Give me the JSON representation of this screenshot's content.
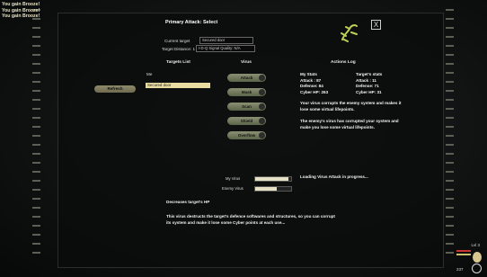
{
  "log": [
    "You gain Brooze!",
    "You gain Brooze!",
    "You gain Brooze!"
  ],
  "window": {
    "title": "Primary Attack: Select",
    "close_label": "X"
  },
  "header": {
    "current_target_label": "Current target",
    "current_target_value": "Secured door",
    "distance_label": "Target Distance: 1",
    "signal_value": "I-D-Q Signal Quality: N/A"
  },
  "targets": {
    "heading": "Targets List",
    "sub": "Me",
    "refresh_label": "Refresh",
    "items": [
      "Secured door"
    ]
  },
  "virus": {
    "heading": "Virus",
    "buttons": [
      "Attack",
      "Mask",
      "Scan",
      "Shield",
      "Overflow"
    ]
  },
  "actions": {
    "heading": "Actions Log"
  },
  "my_stats": {
    "title": "My Stats",
    "attack": "Attack : 87",
    "defense": "Defense: 84",
    "cyber_hp": "Cyber HP: 263"
  },
  "target_stats": {
    "title": "Target's stats",
    "attack": "Attack : 11",
    "defense": "Defense: 71",
    "cyber_hp": "Cyber HP: 31"
  },
  "messages": [
    "Your virus corrupts the enemy system and makes it lose some virtual lifepoints.",
    "The enemy's virus has corrupted your system and make you lose some virtual lifepoints."
  ],
  "loading": "Loading Virus Attack in progress...",
  "bars": {
    "my_virus_label": "My Virus",
    "enemy_virus_label": "Enemy Virus",
    "my_virus_level": 0.92,
    "enemy_virus_level": 0.6
  },
  "description": {
    "title": "Decreases target's HP",
    "body": "This virus destructs the target's defence softwares and structures, so you can corrupt its system and make it lose some Cyber points at each use..."
  },
  "hud": {
    "level": "Lvl 3",
    "counter": "237"
  },
  "colors": {
    "accent": "#e8dca0",
    "button": "#7f8769"
  }
}
